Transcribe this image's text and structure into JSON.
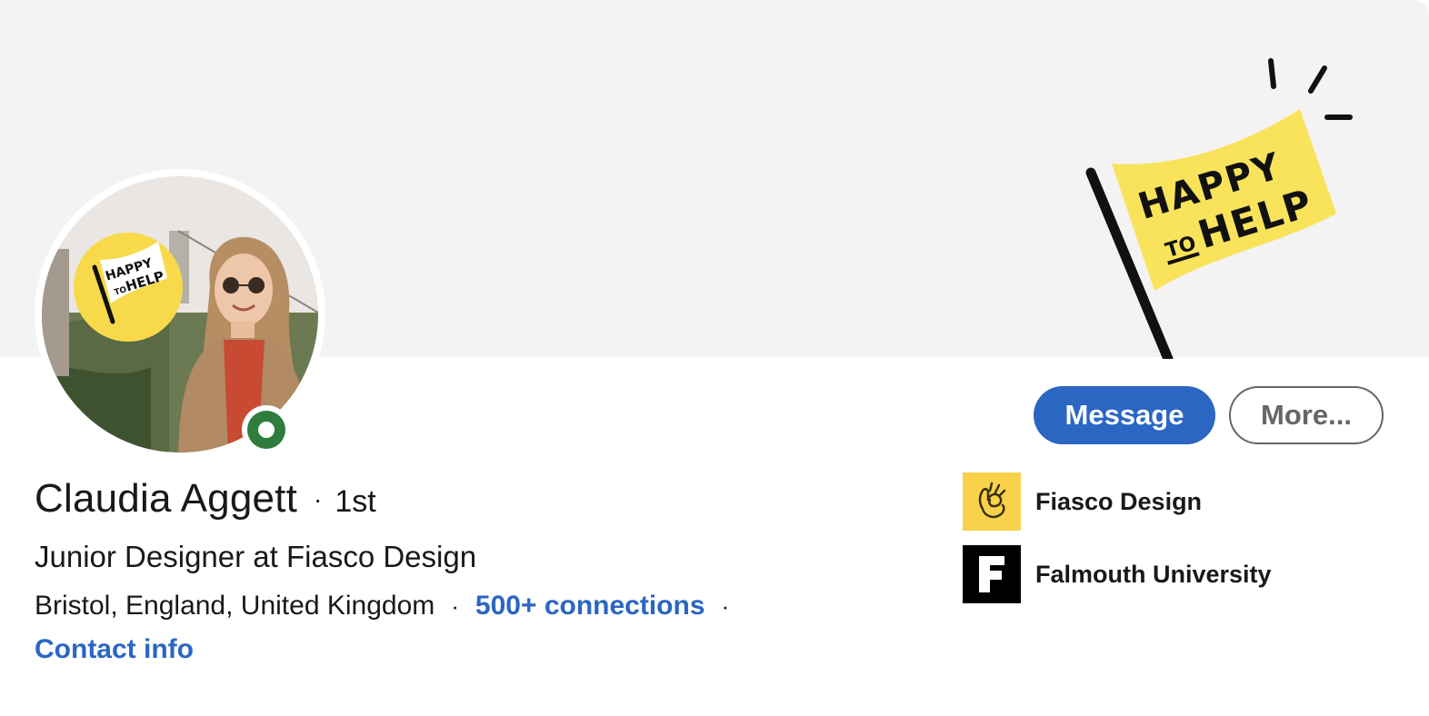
{
  "profile": {
    "name": "Claudia Aggett",
    "degree_separator": "·",
    "degree": "1st",
    "headline": "Junior Designer at Fiasco Design",
    "location": "Bristol, England, United Kingdom",
    "meta_separator": "·",
    "connections": "500+ connections",
    "contact_info": "Contact info",
    "online_status": "online"
  },
  "cover": {
    "flag_line1": "HAPPY",
    "flag_line2_small": "TO",
    "flag_line2": "HELP",
    "background_color": "#f3f3f3",
    "flag_color": "#f8e35a"
  },
  "avatar": {
    "badge_line1": "HAPPY",
    "badge_line2_small": "TO",
    "badge_line2": "HELP",
    "badge_color": "#f8d94a"
  },
  "actions": {
    "message_label": "Message",
    "more_label": "More..."
  },
  "organizations": [
    {
      "name": "Fiasco Design",
      "logo_icon": "ok-hand-icon",
      "logo_color": "#f8d24a"
    },
    {
      "name": "Falmouth University",
      "logo_icon": "letter-f-icon",
      "logo_color": "#000000"
    }
  ],
  "colors": {
    "accent": "#2a66c2",
    "online": "#2e7d3f"
  }
}
